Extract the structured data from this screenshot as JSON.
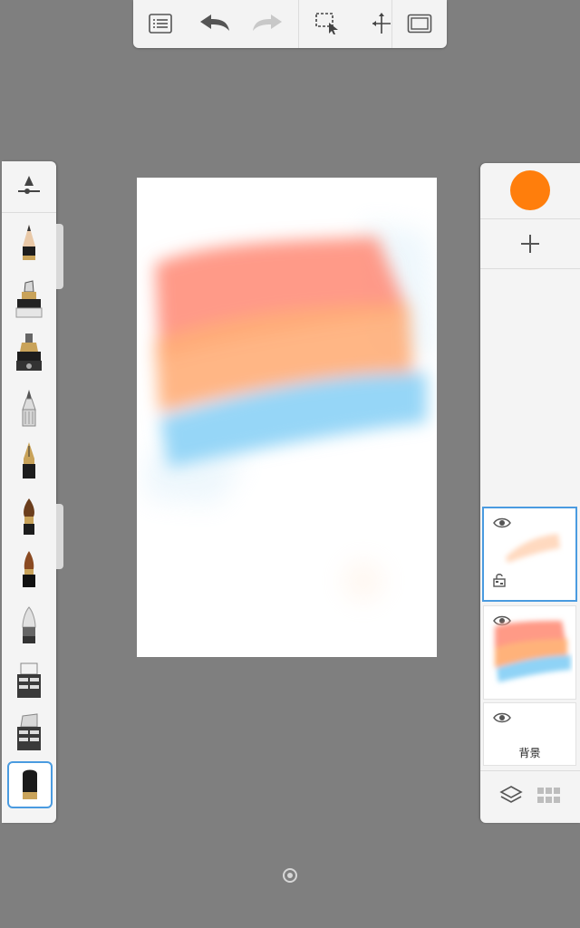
{
  "toolbar": {
    "items": [
      "list-icon",
      "undo-icon",
      "redo-icon",
      "selection-icon",
      "transform-icon",
      "fullscreen-icon"
    ]
  },
  "tools": {
    "settings_icon": "brush-settings-icon",
    "items": [
      "pencil",
      "marker",
      "technical-pen",
      "ballpoint-pen",
      "fountain-pen",
      "round-brush",
      "ink-brush",
      "airbrush",
      "eraser-a",
      "eraser-b",
      "soft-eraser"
    ],
    "selected": "soft-eraser"
  },
  "color": {
    "current": "#ff7e0c"
  },
  "layers": {
    "add_icon": "plus-icon",
    "items": [
      {
        "name": "",
        "visible": true,
        "locked": false,
        "active": true
      },
      {
        "name": "",
        "visible": true,
        "locked": false,
        "active": false
      },
      {
        "name": "背景",
        "visible": true,
        "locked": false,
        "active": false
      }
    ],
    "bottom_icons": [
      "layers-icon",
      "grid-icon"
    ]
  },
  "colors": {
    "accent": "#4a9be0",
    "stroke_red": "#ff8a78",
    "stroke_orange": "#ffb27a",
    "stroke_blue": "#8fd3f6"
  }
}
